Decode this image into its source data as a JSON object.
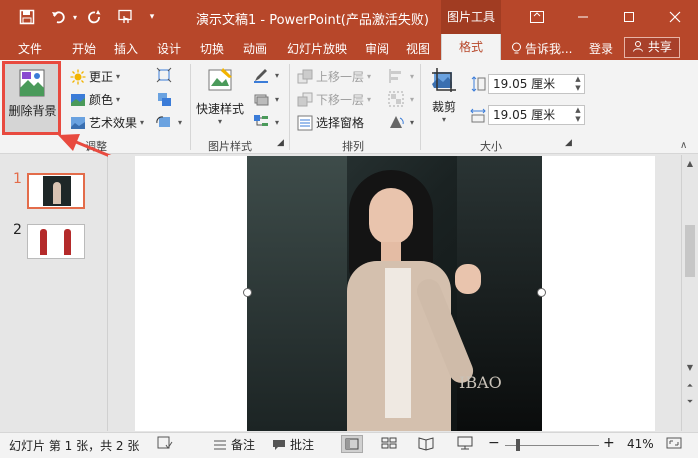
{
  "titlebar": {
    "title": "演示文稿1 - PowerPoint(产品激活失败)",
    "context_tab": "图片工具",
    "icons": [
      "save-icon",
      "undo-icon",
      "redo-icon",
      "touch-mode-icon",
      "customize-icon"
    ],
    "window_controls": [
      "ribbon-options-icon",
      "minimize-icon",
      "maximize-icon",
      "close-icon"
    ]
  },
  "menu": {
    "tabs": [
      "文件",
      "开始",
      "插入",
      "设计",
      "切换",
      "动画",
      "幻灯片放映",
      "审阅",
      "视图"
    ],
    "active_tab": "格式",
    "tell_me": "告诉我...",
    "login": "登录",
    "share": "共享"
  },
  "ribbon": {
    "adjust": {
      "remove_bg": "删除背景",
      "corrections": "更正",
      "color": "颜色",
      "artistic": "艺术效果",
      "label": "调整"
    },
    "styles": {
      "quick_styles": "快速样式",
      "label": "图片样式"
    },
    "arrange": {
      "bring_forward": "上移一层",
      "send_backward": "下移一层",
      "selection_pane": "选择窗格",
      "label": "排列"
    },
    "size": {
      "crop": "裁剪",
      "height": "19.05 厘米",
      "width": "19.05 厘米",
      "label": "大小"
    }
  },
  "slides": [
    {
      "number": "1"
    },
    {
      "number": "2"
    }
  ],
  "photo": {
    "watermark": "IBAO"
  },
  "statusbar": {
    "slide_info": "幻灯片 第 1 张，共 2 张",
    "notes": "备注",
    "comments": "批注",
    "zoom_out": "−",
    "zoom_in": "+",
    "zoom_level": "41%"
  },
  "colors": {
    "accent": "#b7472a",
    "highlight": "#e84a3f"
  }
}
